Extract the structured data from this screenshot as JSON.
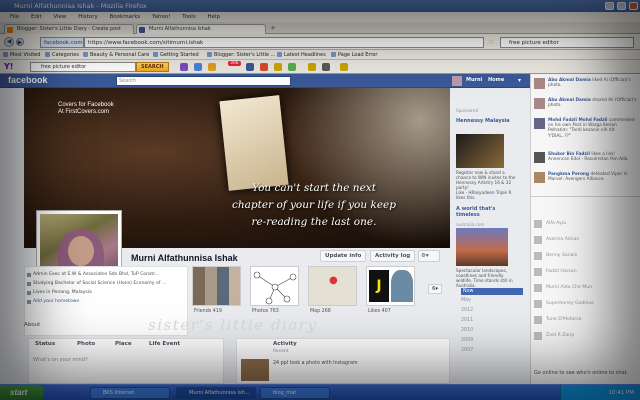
{
  "window": {
    "title": "Murni Alfathunnisa Ishak - Mozilla Firefox"
  },
  "menu": [
    "File",
    "Edit",
    "View",
    "History",
    "Bookmarks",
    "Yahoo!",
    "Tools",
    "Help"
  ],
  "tabs": [
    {
      "label": "Blogger: Sister's Little Diary - Create post",
      "active": false
    },
    {
      "label": "Murni Alfathunnisa Ishak",
      "active": true
    }
  ],
  "nav": {
    "site_label": "facebook.com",
    "url": "https://www.facebook.com/sitimurni.ishak",
    "search_value": "free picture editor"
  },
  "bookmarks": [
    "Most Visited",
    "Categories",
    "Beauty & Personal Care",
    "Getting Started",
    "Blogger: Sister's Little ...",
    "Latest Headlines",
    "Page Load Error"
  ],
  "yahoo": {
    "search_value": "free picture editor",
    "search_button": "SEARCH",
    "badge": "306"
  },
  "fb": {
    "logo": "facebook",
    "search_placeholder": "Search",
    "user": "Murni",
    "home": "Home",
    "cover_credit": "Covers for Facebook\nAt FirstCovers.com",
    "quote": "You can't start the next\nchapter of your life if you keep\nre-reading the last one.",
    "name": "Murni Alfathunnisa Ishak",
    "update_info": "Update info",
    "activity_log": "Activity log",
    "info": [
      "Admin Exec at E.W & Associates Sdn Bhd, TuP Constr...",
      "Studying Bachelor of Social Science (Hons) Economy of ...",
      "Lives in Penang, Malaysia",
      "Add your hometown"
    ],
    "about": "About",
    "thumb_labels": [
      "Friends 419",
      "Photos 763",
      "Map 268",
      "Likes 407"
    ],
    "status_tabs": [
      "Status",
      "Photo",
      "Place",
      "Life Event"
    ],
    "status_placeholder": "What's on your mind?",
    "activity_title": "Activity",
    "activity_sub": "Recent",
    "activity_line": "24 ppl took a photo with Instagram",
    "watermark": "sister's little diary",
    "sponsored": "Sponsored",
    "ads": [
      {
        "title": "Hennessy Malaysia",
        "text": "Register now & stand a chance to WIN invites to the Hennessy Artistry 16 & 32 party!",
        "like": "Like · HRasyadeen Triple R likes this."
      },
      {
        "title": "A world that's timeless",
        "text": "australia.com",
        "like": "Spectacular landscapes, coastlines and friendly wildlife. Time stands still in Australia."
      }
    ],
    "years": [
      "Now",
      "May",
      "2012",
      "2011",
      "2010",
      "2009",
      "2007"
    ]
  },
  "ticker": [
    {
      "name": "Abu Akmal Damia",
      "text": "liked Ai (Official)'s photo."
    },
    {
      "name": "Abu Akmal Damia",
      "text": "shared Ali (Official)'s photo."
    },
    {
      "name": "Mohd Fadzli Mohd Fadzli",
      "text": "commented on his own Post in Warga Kerian Pelhatim: \"Tardi kesanin nih dit Y'DIAL..??\""
    },
    {
      "name": "Shukor Bin Fadzil",
      "text": "likes a link: Annencan Edol - Rasulrrelan Pon Ada."
    },
    {
      "name": "Pangkma Perong",
      "text": "defeated Viper in Marvel: Avengers Alliance."
    }
  ],
  "chat": [
    "Alfa Ayia",
    "Asarina Adnan",
    "Benny Sanais",
    "Fadzil Harsan",
    "Murni Alda Che Mun",
    "Superhoney Godlove",
    "Tune D'Motorsa",
    "Zaid R Zarip"
  ],
  "chat_footer": "Go online to see who's online to chat.",
  "taskbar": {
    "start": "start",
    "tasks": [
      "BKS Internet",
      "Murni Alfathunnisa Ish...",
      "blog_mat"
    ],
    "time": "10:41 PM"
  }
}
